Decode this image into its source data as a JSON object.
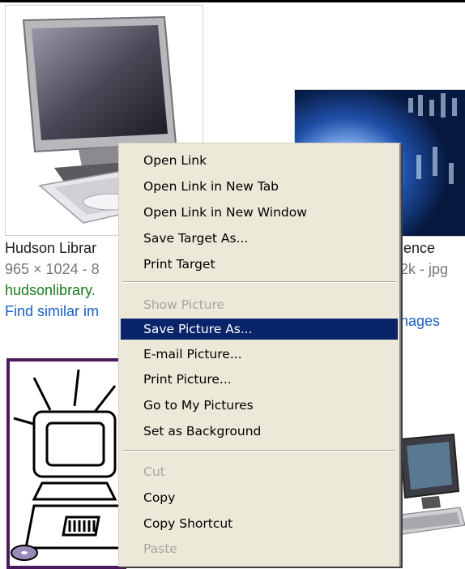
{
  "results": [
    {
      "title": "Hudson Librar",
      "meta": "965 × 1024 - 8",
      "site": "hudsonlibrary.",
      "link": "Find similar im"
    },
    {
      "title": "ience",
      "meta": "2k - jpg",
      "link": "nages"
    }
  ],
  "context_menu": {
    "items": [
      {
        "label": "Open Link",
        "state": "enabled"
      },
      {
        "label": "Open Link in New Tab",
        "state": "enabled"
      },
      {
        "label": "Open Link in New Window",
        "state": "enabled"
      },
      {
        "label": "Save Target As...",
        "state": "enabled"
      },
      {
        "label": "Print Target",
        "state": "enabled"
      },
      {
        "label": "Show Picture",
        "state": "disabled"
      },
      {
        "label": "Save Picture As...",
        "state": "selected"
      },
      {
        "label": "E-mail Picture...",
        "state": "enabled"
      },
      {
        "label": "Print Picture...",
        "state": "enabled"
      },
      {
        "label": "Go to My Pictures",
        "state": "enabled"
      },
      {
        "label": "Set as Background",
        "state": "enabled"
      },
      {
        "label": "Cut",
        "state": "disabled"
      },
      {
        "label": "Copy",
        "state": "enabled"
      },
      {
        "label": "Copy Shortcut",
        "state": "enabled"
      },
      {
        "label": "Paste",
        "state": "disabled"
      }
    ]
  },
  "colors": {
    "menu_background": "#ece9d8",
    "menu_highlight": "#0a246a",
    "site_green": "#1a7b1a",
    "link_blue": "#1a5fc8",
    "meta_gray": "#777777"
  }
}
